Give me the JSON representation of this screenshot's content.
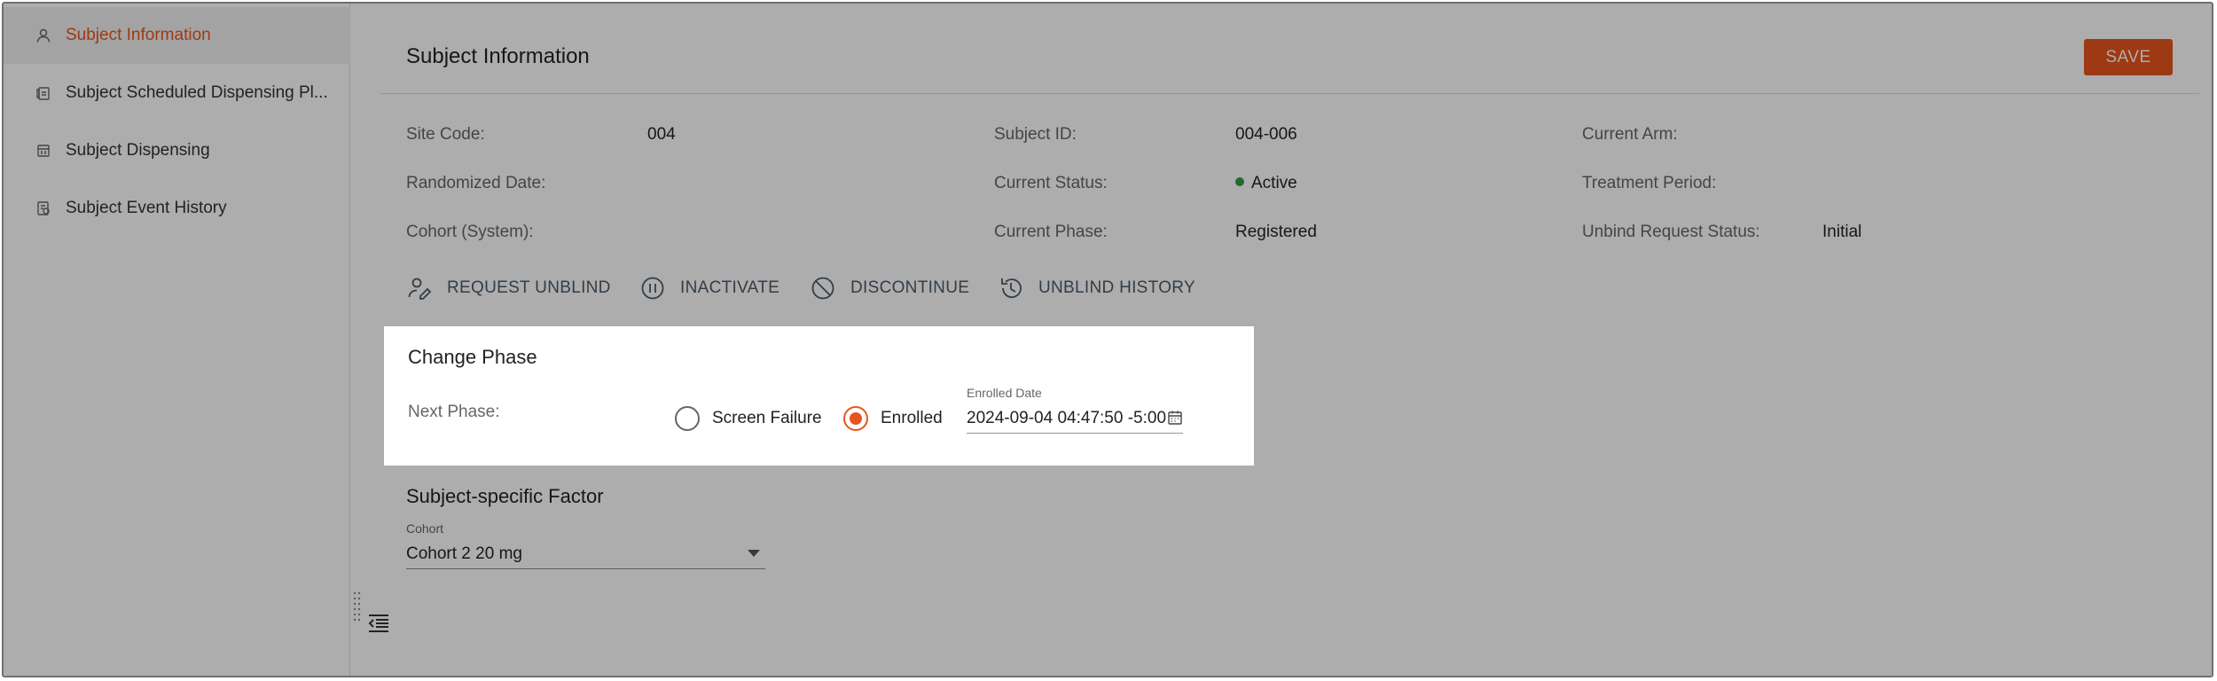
{
  "sidebar": {
    "items": [
      {
        "label": "Subject Information",
        "icon": "person-icon",
        "active": true
      },
      {
        "label": "Subject Scheduled Dispensing Pl...",
        "icon": "clipboard-icon",
        "active": false
      },
      {
        "label": "Subject Dispensing",
        "icon": "dispense-icon",
        "active": false
      },
      {
        "label": "Subject Event History",
        "icon": "history-doc-icon",
        "active": false
      }
    ]
  },
  "header": {
    "title": "Subject Information",
    "save_label": "SAVE"
  },
  "fields": {
    "site_code_label": "Site Code:",
    "site_code_value": "004",
    "randomized_date_label": "Randomized Date:",
    "randomized_date_value": "",
    "cohort_system_label": "Cohort (System):",
    "cohort_system_value": "",
    "subject_id_label": "Subject ID:",
    "subject_id_value": "004-006",
    "current_status_label": "Current Status:",
    "current_status_value": "Active",
    "current_phase_label": "Current Phase:",
    "current_phase_value": "Registered",
    "current_arm_label": "Current Arm:",
    "current_arm_value": "",
    "treatment_period_label": "Treatment Period:",
    "treatment_period_value": "",
    "unbind_status_label": "Unbind Request Status:",
    "unbind_status_value": "Initial"
  },
  "actions": {
    "request_unblind": "REQUEST UNBLIND",
    "inactivate": "INACTIVATE",
    "discontinue": "DISCONTINUE",
    "unblind_history": "UNBLIND HISTORY"
  },
  "change_phase": {
    "title": "Change Phase",
    "next_phase_label": "Next Phase:",
    "options": [
      {
        "label": "Screen Failure",
        "checked": false
      },
      {
        "label": "Enrolled",
        "checked": true
      }
    ],
    "date_label": "Enrolled Date",
    "date_value": "2024-09-04 04:47:50 -5:00"
  },
  "factor": {
    "title": "Subject-specific Factor",
    "cohort_label": "Cohort",
    "cohort_value": "Cohort 2 20 mg"
  },
  "colors": {
    "accent": "#e8551c",
    "status_active": "#2ea043"
  }
}
